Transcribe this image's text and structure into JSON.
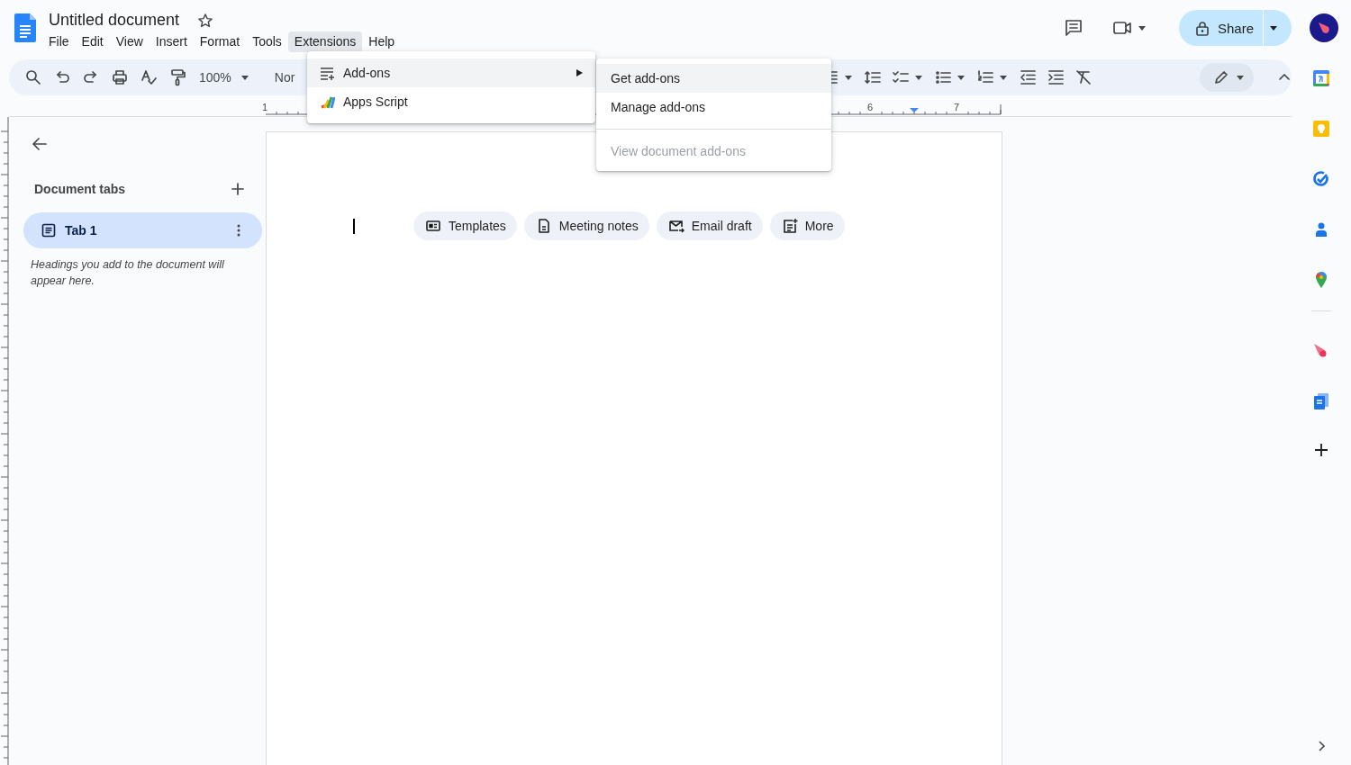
{
  "document": {
    "title": "Untitled document",
    "starred": false
  },
  "menu_bar": [
    {
      "label": "File",
      "selected": false
    },
    {
      "label": "Edit",
      "selected": false
    },
    {
      "label": "View",
      "selected": false
    },
    {
      "label": "Insert",
      "selected": false
    },
    {
      "label": "Format",
      "selected": false
    },
    {
      "label": "Tools",
      "selected": false
    },
    {
      "label": "Extensions",
      "selected": true
    },
    {
      "label": "Help",
      "selected": false
    }
  ],
  "share": {
    "label": "Share"
  },
  "toolbar": {
    "zoom": "100%",
    "style": "Nor"
  },
  "ruler": {
    "labels": [
      "1",
      "6",
      "7"
    ]
  },
  "sidebar": {
    "heading": "Document tabs",
    "tabs": [
      {
        "label": "Tab 1",
        "selected": true
      }
    ],
    "hint": "Headings you add to the document will appear here."
  },
  "chips": [
    {
      "label": "Templates",
      "kind": "templates"
    },
    {
      "label": "Meeting notes",
      "kind": "notes"
    },
    {
      "label": "Email draft",
      "kind": "email"
    },
    {
      "label": "More",
      "kind": "more"
    }
  ],
  "extensions_menu": [
    {
      "label": "Add-ons",
      "kind": "addons",
      "selected": true
    },
    {
      "label": "Apps Script",
      "kind": "script",
      "selected": false
    }
  ],
  "addons_submenu": [
    {
      "label": "Get add-ons",
      "selected": true,
      "disabled": false
    },
    {
      "label": "Manage add-ons",
      "selected": false,
      "disabled": false
    },
    {
      "label": "View document add-ons",
      "selected": false,
      "disabled": true
    }
  ]
}
